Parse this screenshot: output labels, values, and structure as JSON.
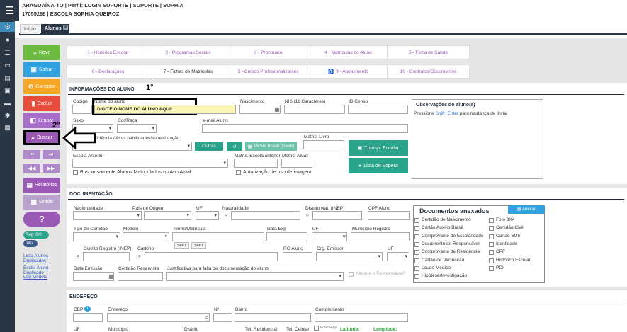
{
  "header": {
    "line1": "ARAGUAÍNA-TO | Perfil: LOGIN SUPORTE | SUPORTE | SOPHIA",
    "line2": "17055288 | ESCOLA SOPHIA QUEIROZ"
  },
  "tabs": {
    "inicio": "Início",
    "alunos": "Alunos",
    "close": "✕"
  },
  "rail_icons": [
    "settings-icon",
    "user-icon",
    "list-icon",
    "card-icon",
    "building-icon",
    "bus-icon",
    "monitor-icon",
    "gear-icon",
    "grid-icon"
  ],
  "actions": {
    "novo": "Novo",
    "salvar": "Salvar",
    "cancelar": "Cancelar",
    "excluir": "Excluir",
    "limpar": "Limpar",
    "buscar": "Buscar",
    "relatorios": "Relatórios",
    "grade": "Grade",
    "help": "?",
    "reg": "Reg: 0/0",
    "info": "Info",
    "link1": "Lista Alunos Duplicados",
    "link2": "Exclui Aluno Duplicado",
    "link3": "Log Modelo"
  },
  "top_tabs": [
    "1 - Histórico Escolar",
    "2 - Programas Sociais",
    "3 - Prontuário",
    "4 - Matrículas do Aluno",
    "5 - Ficha de Saúde",
    "6 - Declarações",
    "7 - Fichas de Matrículas",
    "8 - Cursos Profissionalizantes",
    "9 - Atendimento",
    "10 - Contratos/Documentos"
  ],
  "info_aluno": {
    "title": "INFORMAÇÕES DO ALUNO",
    "codigo": "Codigo",
    "nome_label": "Nome do aluno",
    "nome_value": "DIGITE O NOME DO ALUNO AQUI!",
    "nascimento": "Nascimento",
    "nis": "NIS (11 Caracteres)",
    "id_censo": "ID Censo",
    "sexo": "Sexo",
    "cor": "Cor/Raça",
    "email": "e-mail Aluno",
    "deficiencia": "Tipo de Deficiência / Altas habilidades/superdotação",
    "outras": "Outras",
    "prova_brasil": "Prova Brasil (Saeb)",
    "matr_livro": "Matric. Livro",
    "transp": "Transp. Escolar",
    "escola_anterior": "Escola Anterior",
    "matr_escola_ant": "Matric. Escola anterior",
    "matr_atual": "Matric. Atual:",
    "lista_espera": "Lista de Espera",
    "buscar_matriculados": "Buscar somente Alunos Matriculados no Ano Atual",
    "autorizacao": "Autorização de uso de imagem",
    "obs_title": "Observações do aluno(a)",
    "obs_hint_pre": "Pressione ",
    "obs_hint_key": "Shift+Enter",
    "obs_hint_post": " para mudança de linha."
  },
  "documentacao": {
    "title": "DOCUMENTAÇÃO",
    "nacionalidade": "Nacionalidade",
    "pais": "País de Origem",
    "uf": "UF",
    "naturalidade": "Naturalidade",
    "distrito_nat": "Distrito Nat. (INEP)",
    "cpf": "CPF Aluno",
    "tipo_certidao": "Tipo de Certidão",
    "modelo": "Modelo",
    "termo": "Termo/Matrícula",
    "data_exp": "Data Exp",
    "uf2": "UF",
    "municipio_registro": "Município Registro",
    "distrito_registro": "Distrito Registro (INEP)",
    "cartorio": "Cartório",
    "site1a": "Site1",
    "site1b": "Site1",
    "rg": "RG Aluno",
    "orgao": "Org. Emissor",
    "uf3": "UF",
    "data_emissao": "Data Emissão",
    "certidao_reservista": "Certidão Reservista",
    "justificativa": "Justificativa para falta de documentação do aluno",
    "aluno_responsavel": "Aluno é o Responsável?"
  },
  "docs_anexados": {
    "title": "Documentos anexados",
    "anexar": "Anexar",
    "col1": [
      "Certidão de Nascimento",
      "Cartão Auxílio Brasil",
      "Comprovante de Escolaridade",
      "Documento do Responsável",
      "Comprovante de Residência",
      "Cartão de Vacinação",
      "Laudo Médico",
      "Hipótese/Investigação"
    ],
    "col2": [
      "Foto 3X4",
      "Certidão Civil",
      "Cartão SUS",
      "Identidade",
      "CPF",
      "Histórico Escolar",
      "PDI"
    ]
  },
  "endereco": {
    "title": "ENDEREÇO",
    "cep": "CEP",
    "endereco": "Endereço",
    "numero": "Nº",
    "bairro": "Bairro",
    "complemento": "Complemento",
    "uf": "UF",
    "municipio": "Município",
    "distrito": "Distrito",
    "tel_res": "Tel. Residencial",
    "tel_cel": "Tel. Celular",
    "whatsapp": "WhatsApp",
    "latitude": "Latitude:",
    "longitude": "Longitude:"
  },
  "annotations": {
    "a1": "1°",
    "a2": "2°"
  },
  "colors": {
    "rail": "#2b3645",
    "green": "#6dbb3e",
    "blue": "#2fa0e0",
    "orange": "#f6a623",
    "purple": "#9b59b6",
    "teal": "#2aa48a"
  }
}
